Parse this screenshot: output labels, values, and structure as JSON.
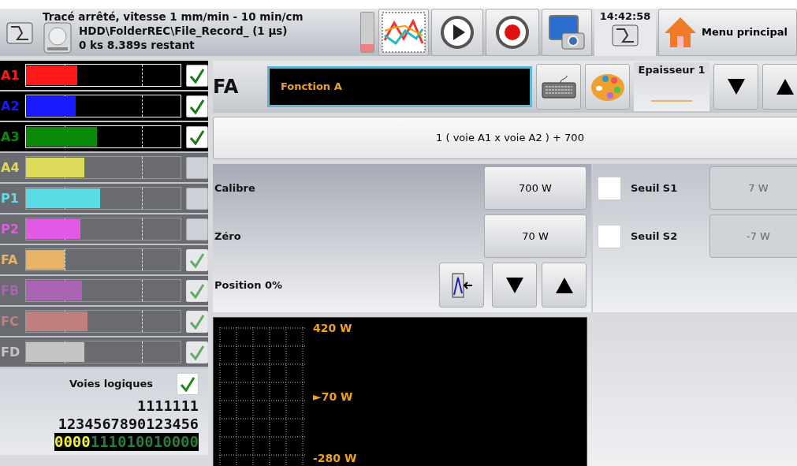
{
  "status": {
    "line_1": "Tracé arrêté, vitesse 1 mm/min - 10 min/cm",
    "line_2": "HDD\\FolderREC\\File_Record_ (1 µs)",
    "line_3": "0 ks 8.389s restant"
  },
  "toolbar": {
    "time": "14:42:58",
    "home_label": "Menu principal"
  },
  "channels": [
    {
      "label": "A1",
      "color": "#ff1a1a",
      "level": 0.33,
      "active": true,
      "checked": true,
      "disabled": false
    },
    {
      "label": "A2",
      "color": "#1a1aff",
      "level": 0.32,
      "active": true,
      "checked": true,
      "disabled": false
    },
    {
      "label": "A3",
      "color": "#0a8a0a",
      "level": 0.46,
      "active": true,
      "checked": true,
      "disabled": false
    },
    {
      "label": "A4",
      "color": "#dcdc5a",
      "level": 0.38,
      "active": false,
      "checked": false,
      "disabled": false
    },
    {
      "label": "P1",
      "color": "#5adce6",
      "level": 0.48,
      "active": false,
      "checked": false,
      "disabled": false
    },
    {
      "label": "P2",
      "color": "#e05ae6",
      "level": 0.35,
      "active": false,
      "checked": false,
      "disabled": false
    },
    {
      "label": "FA",
      "color": "#e6b464",
      "level": 0.25,
      "active": false,
      "checked": true,
      "disabled": true
    },
    {
      "label": "FB",
      "color": "#aa64b4",
      "level": 0.36,
      "active": false,
      "checked": true,
      "disabled": true
    },
    {
      "label": "FC",
      "color": "#c08080",
      "level": 0.4,
      "active": false,
      "checked": true,
      "disabled": true
    },
    {
      "label": "FD",
      "color": "#c4c4c4",
      "level": 0.38,
      "active": false,
      "checked": true,
      "disabled": true
    }
  ],
  "logic": {
    "title": "Voies logiques",
    "checked": true,
    "tens": "1111111",
    "units": "1234567890123456",
    "bits": [
      {
        "text": "0000",
        "highlighted": true
      },
      {
        "text": "111010010000",
        "highlighted": false
      }
    ]
  },
  "function": {
    "code": "FA",
    "name": "Fonction A",
    "thickness_label": "Epaisseur 1",
    "formula": "1 ( voie A1 x voie A2 ) + 700"
  },
  "settings": [
    {
      "label": "Calibre",
      "value": "700 W"
    },
    {
      "label": "Zéro",
      "value": "70 W"
    }
  ],
  "position_label": "Position 0%",
  "thresholds": [
    {
      "label": "Seuil S1",
      "value": "7 W",
      "checked": false
    },
    {
      "label": "Seuil S2",
      "value": "-7 W",
      "checked": false
    }
  ],
  "scale": {
    "top": "420 W",
    "zero": "►70 W",
    "bottom": "-280 W"
  }
}
